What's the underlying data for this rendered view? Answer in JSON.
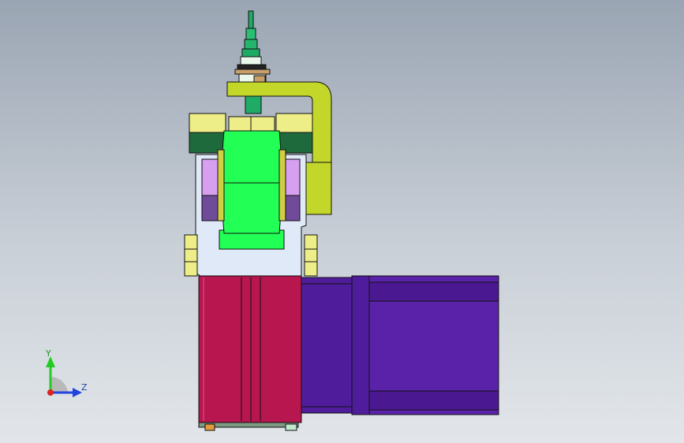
{
  "viewport": {
    "background_top": "#9aa5b3",
    "background_bottom": "#e2e6ea"
  },
  "triad": {
    "y_label": "Y",
    "z_label": "Z",
    "y_color": "#22cc22",
    "z_color": "#2244dd",
    "x_color": "#dd2222"
  },
  "colors": {
    "spindle_green": "#1faa66",
    "bracket_yellow": "#c3d62a",
    "roller_green": "#22ff55",
    "dark_green": "#1e6a3c",
    "pale_yellow": "#eeee88",
    "lilac": "#d79ff0",
    "purple_shadow": "#6f4b9a",
    "frame_blue": "#dfe9f7",
    "motor_red": "#b8164f",
    "motor_purple": "#4f1d9b",
    "outline": "#111111"
  }
}
